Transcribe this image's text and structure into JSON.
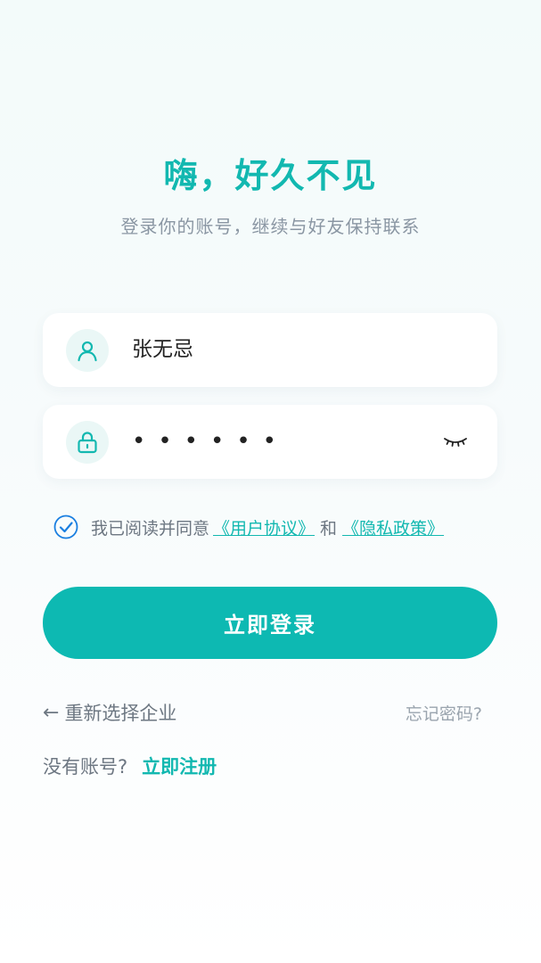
{
  "header": {
    "title": "嗨，好久不见",
    "subtitle": "登录你的账号，继续与好友保持联系"
  },
  "form": {
    "username": {
      "value": "张无忌",
      "icon": "user-icon"
    },
    "password": {
      "masked_value": "••••••",
      "icon": "lock-icon",
      "toggle_icon": "eye-closed-icon"
    },
    "agreement": {
      "checked": true,
      "prefix": "我已阅读并同意",
      "user_agreement": "《用户协议》",
      "conjunction": "和",
      "privacy_policy": "《隐私政策》"
    },
    "submit_label": "立即登录"
  },
  "footer": {
    "reselect_arrow": "←",
    "reselect_label": "重新选择企业",
    "forgot_label": "忘记密码?",
    "no_account_label": "没有账号?",
    "register_label": "立即注册"
  },
  "colors": {
    "accent": "#12b8b0",
    "button": "#0db9b2",
    "muted": "#8a96a3"
  }
}
